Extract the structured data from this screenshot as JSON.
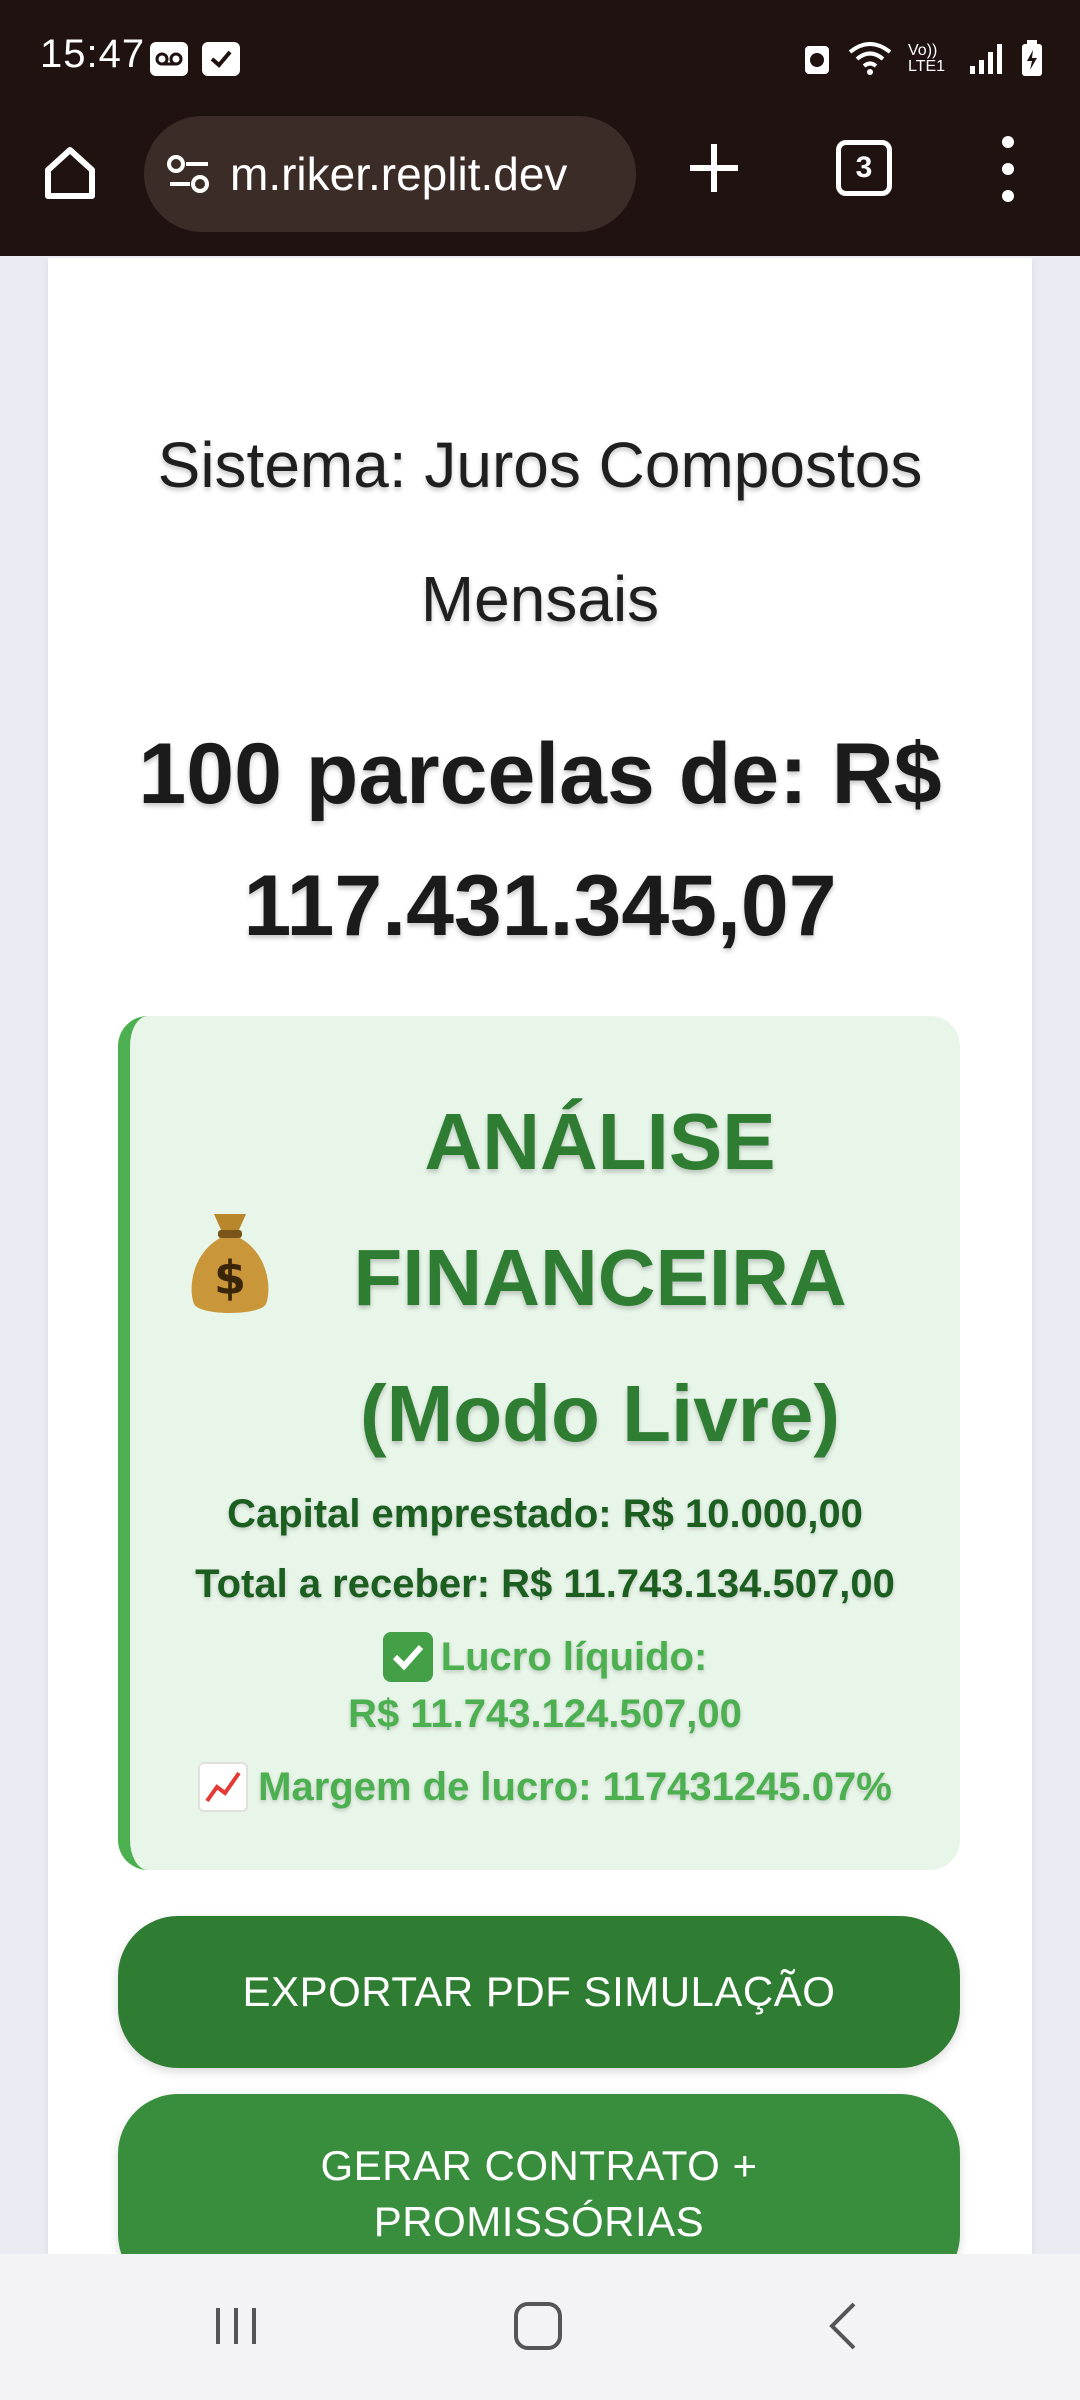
{
  "status_bar": {
    "time": "15:47",
    "network_label": "Vo)) LTE1"
  },
  "browser": {
    "url": "m.riker.replit.dev",
    "tab_count": "3"
  },
  "page": {
    "sistema_title": "Sistema: Juros Compostos Mensais",
    "parcelas_title": "100 parcelas de: R$ 117.431.345,07",
    "analysis": {
      "heading": "ANÁLISE FINANCEIRA (Modo Livre)",
      "icon": "money-bag-icon",
      "capital": "Capital emprestado: R$ 10.000,00",
      "total": "Total a receber: R$ 11.743.134.507,00",
      "lucro_label": "Lucro líquido:",
      "lucro_value": "R$ 11.743.124.507,00",
      "margem": "Margem de lucro: 117431245.07%"
    },
    "buttons": {
      "export_pdf": "EXPORTAR PDF SIMULAÇÃO",
      "contract_line1": "GERAR CONTRATO +",
      "contract_line2": "PROMISSÓRIAS"
    }
  },
  "colors": {
    "toolbar_bg": "#1f1210",
    "url_pill_bg": "#3b2c28",
    "analysis_bg": "#e8f5e9",
    "analysis_border": "#4caf50",
    "heading_green": "#2e7d32",
    "dark_green_text": "#1b5e20",
    "light_green_text": "#4caf50",
    "btn_export": "#2e7d32",
    "btn_contract": "#388e3c"
  }
}
